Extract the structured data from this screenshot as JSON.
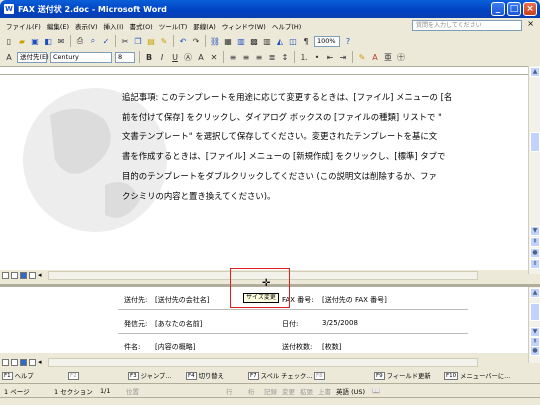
{
  "window": {
    "title": "FAX 送付状 2.doc - Microsoft Word"
  },
  "menu": {
    "items": [
      "ファイル(F)",
      "編集(E)",
      "表示(V)",
      "挿入(I)",
      "書式(O)",
      "ツール(T)",
      "罫線(A)",
      "ウィンドウ(W)",
      "ヘルプ(H)"
    ],
    "ask_placeholder": "質問を入力してください"
  },
  "toolbar": {
    "zoom": "100%",
    "style": "送付先(E)",
    "font": "Century",
    "size": "8"
  },
  "document": {
    "lines": [
      "追記事項: このテンプレートを用途に応じて変更するときは、[ファイル] メニューの [名",
      "前を付けて保存] をクリックし、ダイアログ ボックスの [ファイルの種類] リストで \"",
      "文書テンプレート\" を選択して保存してください。変更されたテンプレートを基に文",
      "書を作成するときは、[ファイル] メニューの [新規作成] をクリックし、[標準] タブで",
      "目的のテンプレートをダブルクリックしてください (この説明文は削除するか、ファ",
      "クシミリの内容と置き換えてください)。"
    ]
  },
  "tooltip": "サイズ変更",
  "fields": {
    "to_label": "送付先:",
    "to_value": "[送付先の会社名]",
    "fax_label": "FAX 番号:",
    "fax_value": "[送付先の FAX 番号]",
    "from_label": "発信元:",
    "from_value": "[あなたの名前]",
    "date_label": "日付:",
    "date_value": "3/25/2008",
    "subject_label": "件名:",
    "subject_value": "[内容の概略]",
    "pages_label": "送付枚数:",
    "pages_value": "[枚数]"
  },
  "fkeys": [
    {
      "key": "F1",
      "label": "ヘルプ",
      "dim": false
    },
    {
      "key": "F2",
      "label": "",
      "dim": true
    },
    {
      "key": "F3",
      "label": "ジャンプ...",
      "dim": false
    },
    {
      "key": "F4",
      "label": "切り替え",
      "dim": false
    },
    {
      "key": "F7",
      "label": "スペル チェック...",
      "dim": false
    },
    {
      "key": "F8",
      "label": "",
      "dim": true
    },
    {
      "key": "F9",
      "label": "フィールド更新",
      "dim": false
    },
    {
      "key": "F10",
      "label": "メニューバーに...",
      "dim": false
    }
  ],
  "status": {
    "page": "1 ページ",
    "section": "1 セクション",
    "pos": "1/1",
    "loc": "位置",
    "line": "行",
    "col": "桁",
    "rec": "記録",
    "trk": "変更",
    "ext": "拡張",
    "ovr": "上書",
    "lang": "英語 (US)"
  }
}
